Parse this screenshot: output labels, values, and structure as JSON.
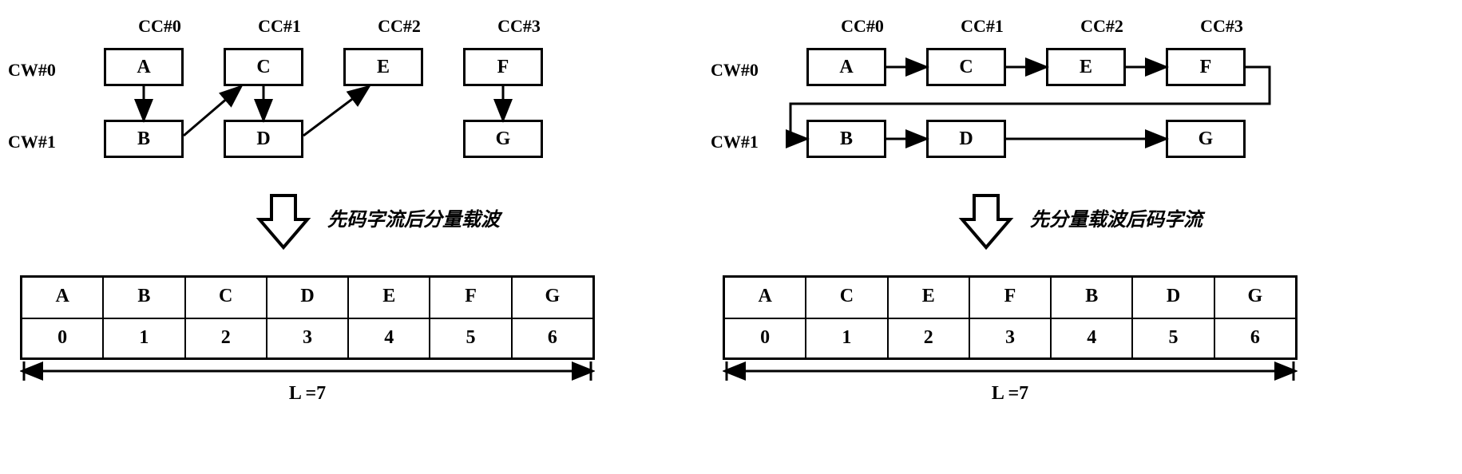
{
  "col_headers": [
    "CC#0",
    "CC#1",
    "CC#2",
    "CC#3"
  ],
  "row_labels": [
    "CW#0",
    "CW#1"
  ],
  "grid": {
    "r0": [
      "A",
      "C",
      "E",
      "F"
    ],
    "r1": {
      "c0": "B",
      "c1": "D",
      "c3": "G"
    }
  },
  "left": {
    "caption": "先码字流后分量载波",
    "sequence": [
      "A",
      "B",
      "C",
      "D",
      "E",
      "F",
      "G"
    ],
    "indices": [
      "0",
      "1",
      "2",
      "3",
      "4",
      "5",
      "6"
    ]
  },
  "right": {
    "caption": "先分量载波后码字流",
    "sequence": [
      "A",
      "C",
      "E",
      "F",
      "B",
      "D",
      "G"
    ],
    "indices": [
      "0",
      "1",
      "2",
      "3",
      "4",
      "5",
      "6"
    ]
  },
  "length_label": "L =7"
}
